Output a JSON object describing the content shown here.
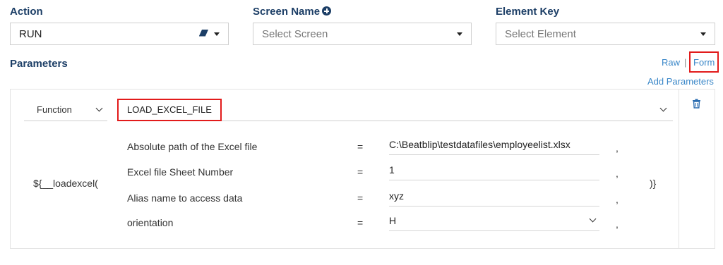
{
  "action": {
    "label": "Action",
    "value": "RUN"
  },
  "screen": {
    "label": "Screen Name",
    "placeholder": "Select Screen"
  },
  "element": {
    "label": "Element Key",
    "placeholder": "Select Element"
  },
  "parameters": {
    "label": "Parameters",
    "raw_link": "Raw",
    "separator": "|",
    "form_link": "Form",
    "add_link": "Add Parameters",
    "function_label": "Function",
    "function_value": "LOAD_EXCEL_FILE",
    "prefix": "${__loadexcel(",
    "suffix": ")}",
    "rows": [
      {
        "name": "Absolute path of the Excel file",
        "eq": "=",
        "value": "C:\\Beatblip\\testdatafiles\\employeelist.xlsx",
        "comma": ","
      },
      {
        "name": "Excel file Sheet Number",
        "eq": "=",
        "value": "1",
        "comma": ","
      },
      {
        "name": "Alias name to access data",
        "eq": "=",
        "value": "xyz",
        "comma": ","
      },
      {
        "name": "orientation",
        "eq": "=",
        "value": "H",
        "comma": ","
      }
    ]
  },
  "icons": {
    "add_screen": "plus-circle-icon",
    "eraser": "eraser-icon",
    "delete": "trash-icon"
  },
  "colors": {
    "heading": "#1c3e66",
    "link": "#3a87c8",
    "highlight": "#e21b1b"
  }
}
